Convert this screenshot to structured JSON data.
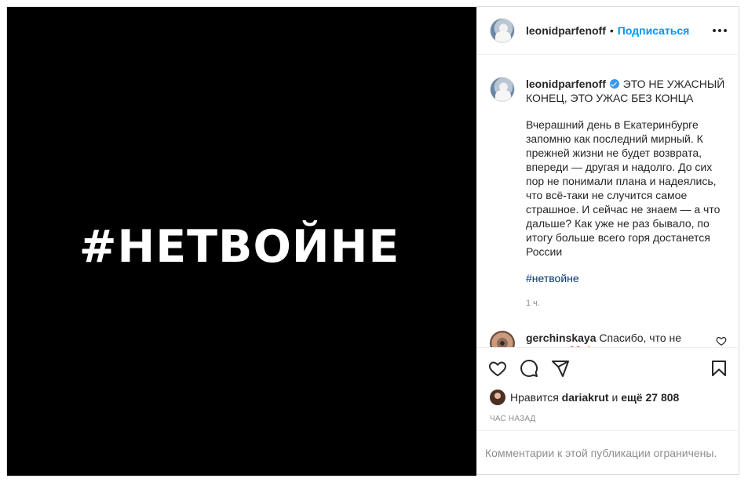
{
  "media": {
    "text": "#НЕТВОЙНЕ"
  },
  "header": {
    "username": "leonidparfenoff",
    "dot": "•",
    "follow_label": "Подписаться"
  },
  "caption": {
    "username": "leonidparfenoff",
    "title": "ЭТО НЕ УЖАСНЫЙ КОНЕЦ, ЭТО УЖАС БЕЗ КОНЦА",
    "body": "Вчерашний день в Екатеринбурге запомню как последний мирный. К прежней жизни не будет возврата, впереди — другая и надолго. До сих пор не понимали плана и надеялись, что всё-таки не случится самое страшное. И сейчас не знаем — а что дальше? Как уже не раз бывало, по итогу больше всего горя достанется России",
    "hashtag": "#нетвойне",
    "time_ago": "1 ч."
  },
  "reply": {
    "username": "gerchinskaya",
    "text": "Спасибо, что не молчите❤️🙏"
  },
  "likes": {
    "prefix": "Нравится",
    "user": "dariakrut",
    "conj": "и",
    "more": "ещё 27 808"
  },
  "timestamp": "ЧАС НАЗАД",
  "comments_limited": "Комментарии к этой публикации ограничены.",
  "colors": {
    "accent": "#0095f6",
    "hashtag": "#00376b",
    "muted": "#8e8e8e",
    "text": "#262626"
  },
  "icons": [
    "heart-icon",
    "comment-icon",
    "share-icon",
    "bookmark-icon",
    "more-icon",
    "verified-icon"
  ]
}
